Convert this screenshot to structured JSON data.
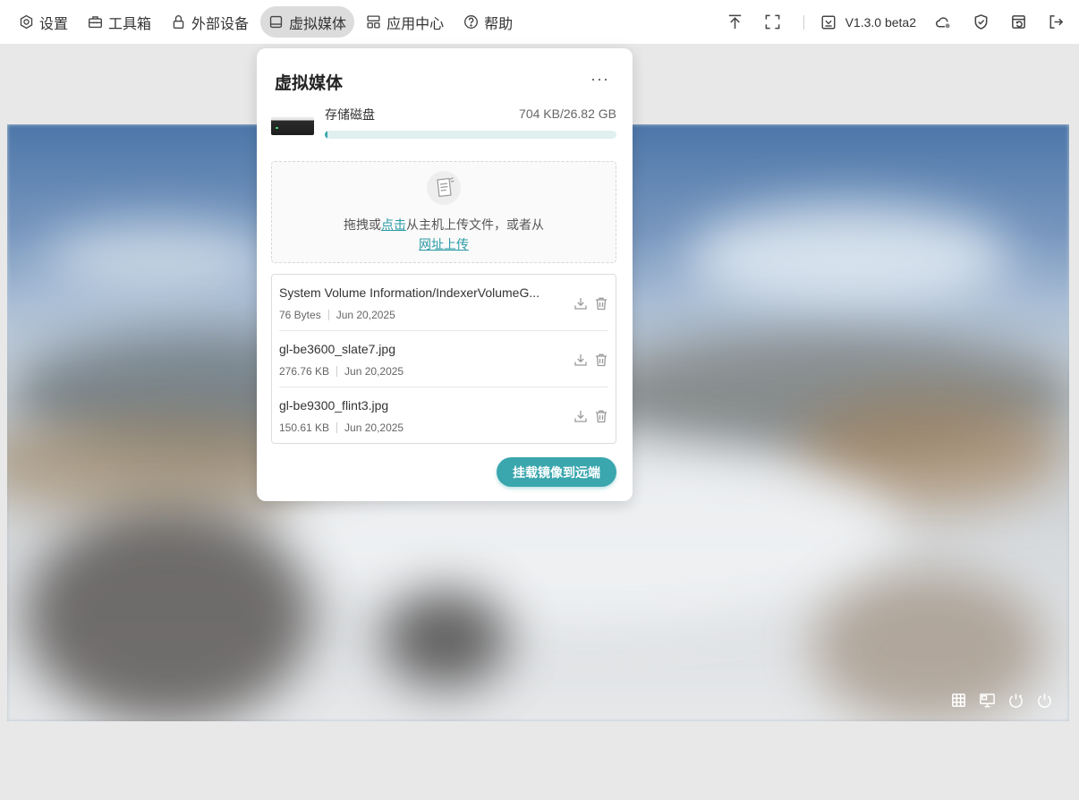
{
  "topbar": {
    "menu": [
      {
        "label": "设置",
        "icon": "settings-icon"
      },
      {
        "label": "工具箱",
        "icon": "toolbox-icon"
      },
      {
        "label": "外部设备",
        "icon": "lock-device-icon"
      },
      {
        "label": "虚拟媒体",
        "icon": "media-drive-icon",
        "active": true
      },
      {
        "label": "应用中心",
        "icon": "apps-grid-icon"
      },
      {
        "label": "帮助",
        "icon": "help-circle-icon"
      }
    ],
    "tools": {
      "upload_icon": "upload-top-icon",
      "fullscreen_icon": "fullscreen-icon",
      "version": "V1.3.0 beta2",
      "cloud_icon": "cloud-status-icon",
      "shield_icon": "shield-check-icon",
      "switch_icon": "window-switch-icon",
      "logout_icon": "logout-icon"
    }
  },
  "panel": {
    "title": "虚拟媒体",
    "more": "···",
    "disk": {
      "label": "存储磁盘",
      "size": "704 KB/26.82 GB",
      "usage_fraction": 0.01
    },
    "dropzone": {
      "prefix": "拖拽或",
      "click_link": "点击",
      "suffix": "从主机上传文件，或者从",
      "url_link": "网址上传"
    },
    "files": [
      {
        "name": "System Volume Information/IndexerVolumeG...",
        "size": "76 Bytes",
        "date": "Jun 20,2025"
      },
      {
        "name": "gl-be3600_slate7.jpg",
        "size": "276.76 KB",
        "date": "Jun 20,2025"
      },
      {
        "name": "gl-be9300_flint3.jpg",
        "size": "150.61 KB",
        "date": "Jun 20,2025"
      }
    ],
    "mount_button": "挂载镜像到远端"
  },
  "screen_toolbar": {
    "icons": [
      "keyboard-grid-icon",
      "monitor-icon",
      "power-cycle-icon",
      "power-icon"
    ]
  },
  "colors": {
    "accent": "#3aa6ad",
    "active_menu_bg": "#dcdcdc",
    "page_bg": "#e8e8e8"
  }
}
